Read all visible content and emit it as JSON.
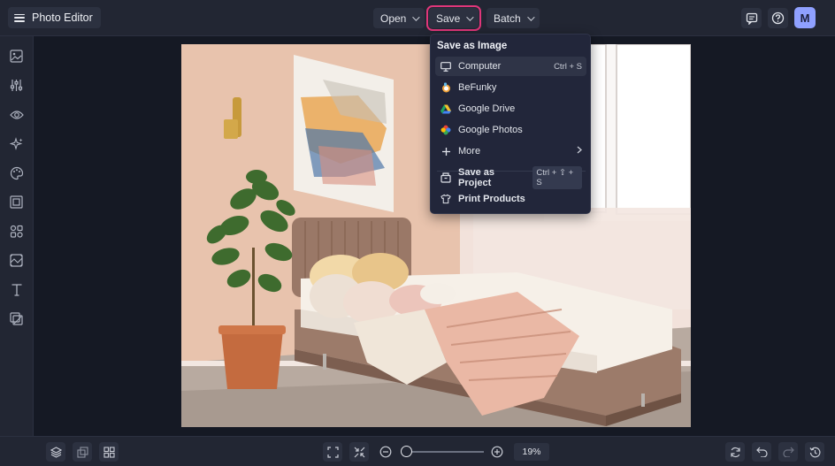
{
  "header": {
    "app_title": "Photo Editor",
    "menus": {
      "open": "Open",
      "save": "Save",
      "batch": "Batch"
    },
    "avatar_initial": "M"
  },
  "save_menu": {
    "section_title": "Save as Image",
    "items": [
      {
        "label": "Computer",
        "shortcut": "Ctrl + S",
        "icon": "monitor-icon"
      },
      {
        "label": "BeFunky",
        "icon": "befunky-logo-icon"
      },
      {
        "label": "Google Drive",
        "icon": "google-drive-icon"
      },
      {
        "label": "Google Photos",
        "icon": "google-photos-icon"
      },
      {
        "label": "More",
        "icon": "plus-icon"
      }
    ],
    "project": {
      "label": "Save as Project",
      "shortcut": "Ctrl + ⇧ + S"
    },
    "print": {
      "label": "Print Products"
    }
  },
  "sidebar_tools": [
    "image-manager-icon",
    "adjust-sliders-icon",
    "eye-icon",
    "effects-sparkle-icon",
    "artsy-palette-icon",
    "frames-icon",
    "graphics-icon",
    "overlays-icon",
    "text-icon",
    "textures-icon"
  ],
  "zoom": {
    "level_text": "19%",
    "slider_fraction": 0.03
  },
  "colors": {
    "accent_highlight": "#e0367a",
    "avatar": "#8fa0ff",
    "panel": "#222633"
  }
}
